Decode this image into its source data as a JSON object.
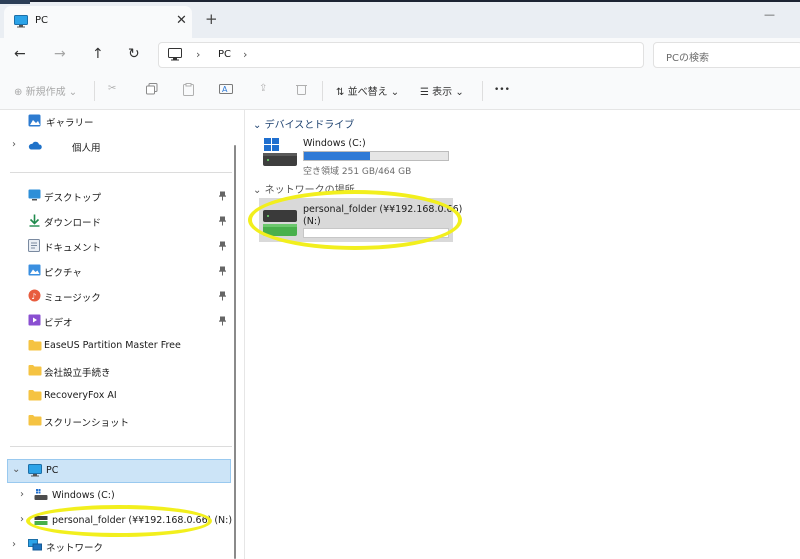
{
  "tab": {
    "title": "PC",
    "close_glyph": "✕",
    "new_tab_glyph": "+"
  },
  "window": {
    "minimize_glyph": "—"
  },
  "nav": {
    "back": "←",
    "forward": "→",
    "up": "↑",
    "refresh": "↻"
  },
  "address": {
    "sep": "›",
    "crumb": "PC"
  },
  "search": {
    "placeholder": "PCの検索"
  },
  "commands": {
    "new_label": "新規作成",
    "sort_label": "並べ替え",
    "view_label": "表示",
    "more_glyph": "•••",
    "caret": "⌄"
  },
  "sidebar": {
    "gallery": "ギャラリー",
    "onedrive": "個人用",
    "quick": [
      {
        "label": "デスクトップ",
        "icon": "desktop-icon"
      },
      {
        "label": "ダウンロード",
        "icon": "download-icon"
      },
      {
        "label": "ドキュメント",
        "icon": "document-icon"
      },
      {
        "label": "ピクチャ",
        "icon": "pictures-icon"
      },
      {
        "label": "ミュージック",
        "icon": "music-icon"
      },
      {
        "label": "ビデオ",
        "icon": "video-icon"
      },
      {
        "label": "EaseUS Partition Master Free",
        "icon": "folder-icon"
      },
      {
        "label": "会社設立手続き",
        "icon": "folder-icon"
      },
      {
        "label": "RecoveryFox AI",
        "icon": "folder-icon"
      },
      {
        "label": "スクリーンショット",
        "icon": "folder-icon"
      }
    ],
    "pin_glyph": "📌",
    "pc": "PC",
    "windows_drive": "Windows (C:)",
    "network_drive": "personal_folder (¥¥192.168.0.66) (N:)",
    "network": "ネットワーク",
    "chevron_right": "›",
    "chevron_down": "⌄"
  },
  "content": {
    "devices_heading": "デバイスとドライブ",
    "network_heading": "ネットワークの場所",
    "drive_c": {
      "name": "Windows (C:)",
      "usage": "空き領域 251 GB/464 GB",
      "used_fraction": 0.46
    },
    "drive_n": {
      "name": "personal_folder (¥¥192.168.0.66)",
      "letter": "(N:)"
    }
  },
  "colors": {
    "accent": "#2f7ad6",
    "highlight": "#f2ef1d",
    "selection": "#cce4f7",
    "folder": "#f5c342"
  }
}
